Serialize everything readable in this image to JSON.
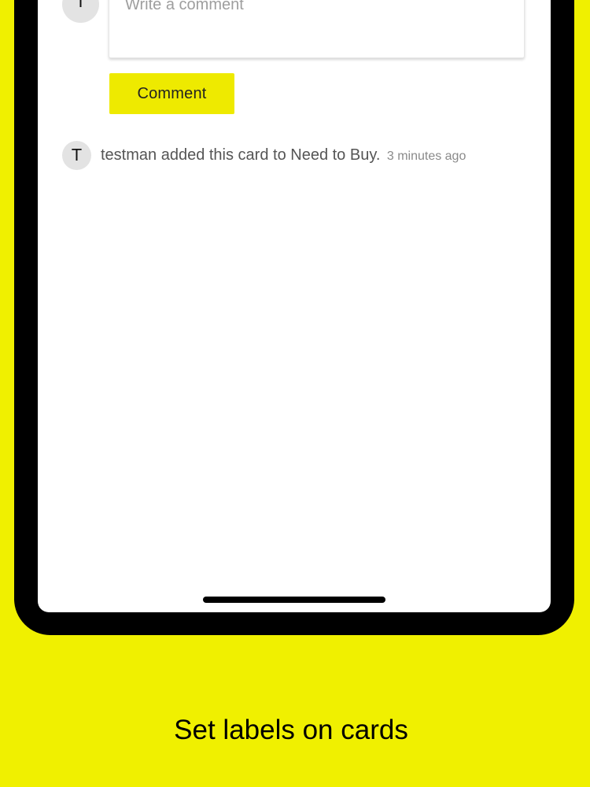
{
  "comment_form": {
    "avatar_initial": "T",
    "placeholder": "Write a comment",
    "submit_label": "Comment"
  },
  "activity": {
    "avatar_initial": "T",
    "message": "testman added this card to Need to Buy.",
    "time": "3 minutes ago"
  },
  "caption": "Set labels on cards",
  "colors": {
    "background": "#f0f000",
    "button": "#eeea00"
  }
}
